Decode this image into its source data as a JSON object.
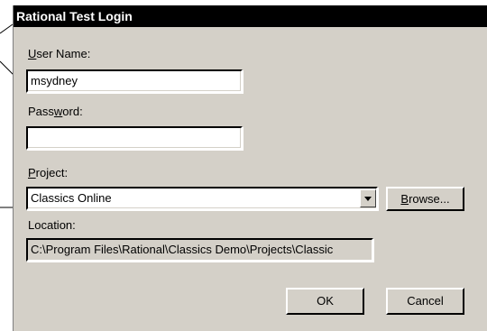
{
  "dialog": {
    "title": "Rational Test Login",
    "user_name_label": "User Name:",
    "user_name_value": "msydney",
    "password_label": "Password:",
    "password_value": "",
    "project_label": "Project:",
    "project_value": "Classics Online",
    "browse_label": "Browse...",
    "location_label": "Location:",
    "location_value": "C:\\Program Files\\Rational\\Classics Demo\\Projects\\Classic",
    "ok_label": "OK",
    "cancel_label": "Cancel"
  }
}
